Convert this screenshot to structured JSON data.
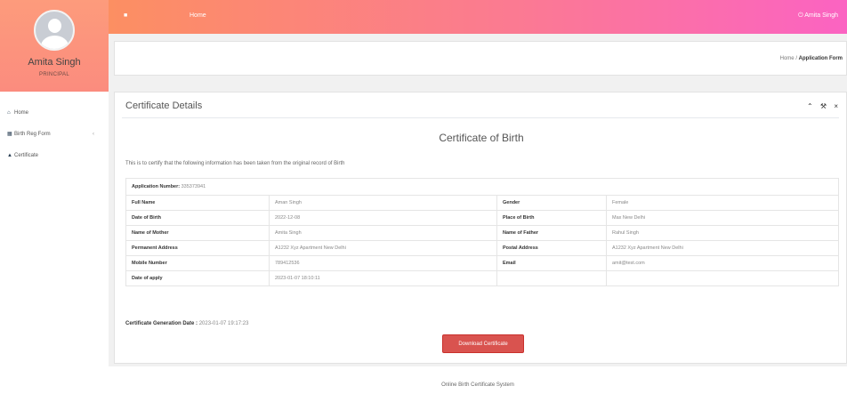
{
  "app": {
    "footer": "Online Birth Certificate System"
  },
  "profile": {
    "name": "Amita Singh",
    "role": "PRINCIPAL"
  },
  "sidebar": {
    "items": [
      {
        "label": "Home",
        "icon": "home-icon"
      },
      {
        "label": "Birth Reg Form",
        "icon": "form-icon",
        "has_submenu": true
      },
      {
        "label": "Certificate",
        "icon": "certificate-icon"
      }
    ]
  },
  "topbar": {
    "home_label": "Home",
    "user_label": "Amita Singh"
  },
  "breadcrumb": {
    "home": "Home",
    "current": "Application Form",
    "separator": "/"
  },
  "card": {
    "title": "Certificate Details",
    "heading": "Certificate of Birth",
    "intro": "This is to certify that the following information has been taken from the original record of Birth"
  },
  "details": {
    "application_number_label": "Application Number:",
    "application_number": "335373941",
    "rows": [
      {
        "label1": "Full Name",
        "value1": "Aman Singh",
        "label2": "Gender",
        "value2": "Female"
      },
      {
        "label1": "Date of Birth",
        "value1": "2022-12-08",
        "label2": "Place of Birth",
        "value2": "Max New Delhi"
      },
      {
        "label1": "Name of Mother",
        "value1": "Amita Singh",
        "label2": "Name of Father",
        "value2": "Rahul Singh"
      },
      {
        "label1": "Permanent Address",
        "value1": "A1232 Xyz Apartment New Delhi",
        "label2": "Postal Address",
        "value2": "A1232 Xyz Apartment New Delhi"
      },
      {
        "label1": "Mobile Number",
        "value1": "789412536",
        "label2": "Email",
        "value2": "amit@test.com"
      },
      {
        "label1": "Date of apply",
        "value1": "2023-01-07 18:10:11",
        "label2": "",
        "value2": ""
      }
    ]
  },
  "generation": {
    "label": "Certificate Generation Date :",
    "date": "2023-01-07 19:17:23"
  },
  "download_label": "Download Certificate",
  "colors": {
    "topbar_start": "#fc8f62",
    "topbar_end": "#fb63c2",
    "button": "#d9534f"
  }
}
